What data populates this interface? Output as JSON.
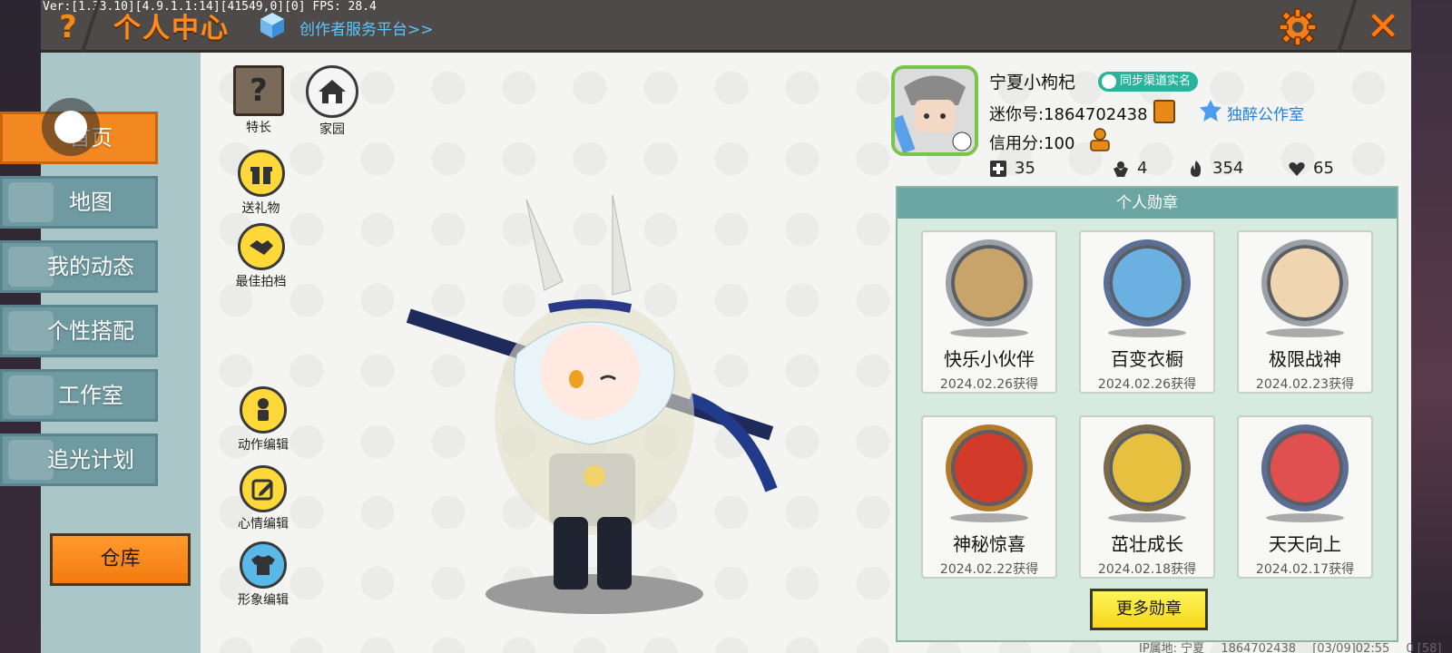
{
  "debug": {
    "version_text": "Ver:[1.33.10][4.9.1.1:14][41549,0][0] FPS: 28.4"
  },
  "header": {
    "help_glyph": "?",
    "title": "个人中心",
    "creator_link": "创作者服务平台>>",
    "close_glyph": "✕"
  },
  "sidebar": {
    "items": [
      {
        "label": "首页",
        "icon": "home-icon",
        "active": true
      },
      {
        "label": "地图",
        "icon": "map-icon",
        "active": false
      },
      {
        "label": "我的动态",
        "icon": "bell-icon",
        "active": false
      },
      {
        "label": "个性搭配",
        "icon": "outfit-icon",
        "active": false
      },
      {
        "label": "工作室",
        "icon": "studio-icon",
        "active": false
      },
      {
        "label": "追光计划",
        "icon": "plan-icon",
        "active": false
      }
    ],
    "warehouse_label": "仓库"
  },
  "tools": {
    "specialty": "特长",
    "home": "家园",
    "gift": "送礼物",
    "partner": "最佳拍档",
    "action_edit": "动作编辑",
    "mood_edit": "心情编辑",
    "avatar_edit": "形象编辑"
  },
  "profile": {
    "nickname": "宁夏小枸杞",
    "verify_badge": "同步渠道实名",
    "mini_id": "迷你号:1864702438",
    "studio_name": "独醉公作室",
    "credit": "信用分:100",
    "stats": [
      {
        "icon": "plus-icon",
        "value": "35"
      },
      {
        "icon": "fan-icon",
        "value": "4"
      },
      {
        "icon": "fire-icon",
        "value": "354"
      },
      {
        "icon": "heart-icon",
        "value": "65"
      }
    ]
  },
  "medals": {
    "header": "个人勋章",
    "items": [
      {
        "name": "快乐小伙伴",
        "date": "2024.02.26获得",
        "color": "#c8a46a",
        "ring": "#9aa0a6"
      },
      {
        "name": "百变衣橱",
        "date": "2024.02.26获得",
        "color": "#6ab0e0",
        "ring": "#5b6f96"
      },
      {
        "name": "极限战神",
        "date": "2024.02.23获得",
        "color": "#f0d6b0",
        "ring": "#9aa0a6"
      },
      {
        "name": "神秘惊喜",
        "date": "2024.02.22获得",
        "color": "#d23a2a",
        "ring": "#b07a2a"
      },
      {
        "name": "茁壮成长",
        "date": "2024.02.18获得",
        "color": "#e8c040",
        "ring": "#7a6a4a"
      },
      {
        "name": "天天向上",
        "date": "2024.02.17获得",
        "color": "#e05050",
        "ring": "#5b6f96"
      }
    ],
    "more_label": "更多勋章"
  },
  "footer": {
    "ip_location": "IP属地: 宁夏",
    "uid": "1864702438",
    "timestamp": "[03/09]02:55",
    "extra": "0  [58]"
  },
  "colors": {
    "accent": "#f2881f",
    "topbar": "#4d4a49",
    "sidebar": "#6f9aa1",
    "panel": "#d6eadf",
    "link": "#1e7fe0"
  }
}
